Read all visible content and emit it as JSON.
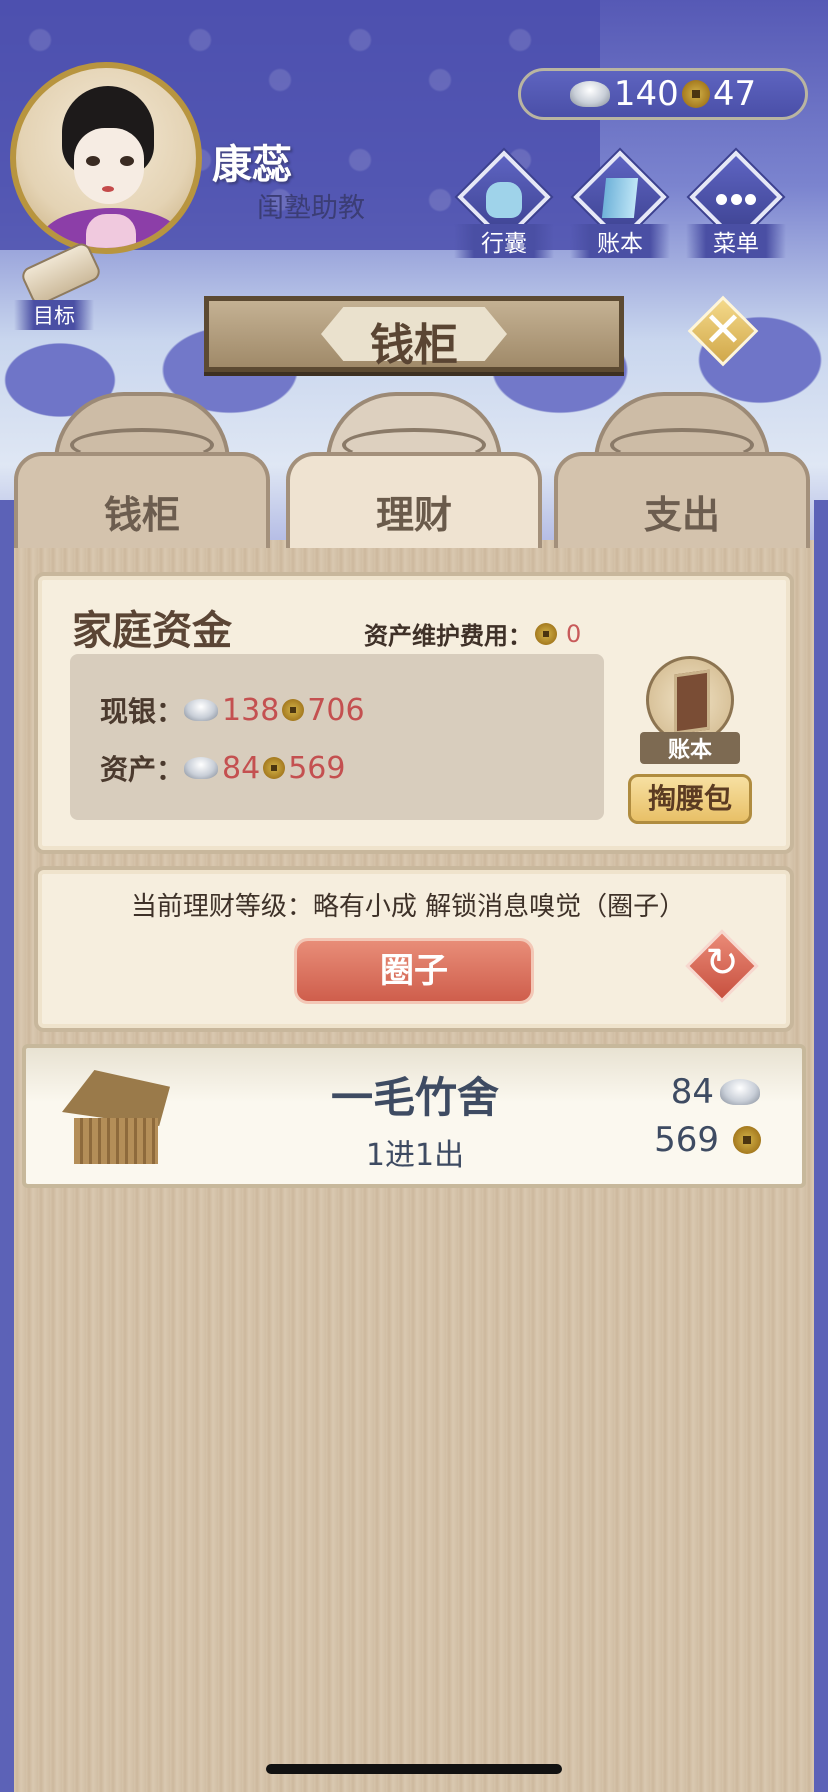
{
  "header": {
    "player_name": "康蕊",
    "player_title": "闺塾助教",
    "silver": "140",
    "coins": "47",
    "buttons": [
      {
        "label": "行囊",
        "icon": "bag-icon"
      },
      {
        "label": "账本",
        "icon": "ledger-icon"
      },
      {
        "label": "菜单",
        "icon": "menu-dots-icon"
      }
    ],
    "goal_label": "目标"
  },
  "title": "钱柜",
  "tabs": [
    {
      "label": "钱柜",
      "active": false
    },
    {
      "label": "理财",
      "active": true
    },
    {
      "label": "支出",
      "active": false
    }
  ],
  "family_funds": {
    "title": "家庭资金",
    "upkeep_label": "资产维护费用：",
    "upkeep_value": "0",
    "cash_label": "现银：",
    "cash_silver": "138",
    "cash_coins": "706",
    "assets_label": "资产：",
    "assets_silver": "84",
    "assets_coins": "569",
    "ledger_label": "账本",
    "pocket_label": "掏腰包"
  },
  "finance": {
    "level_text": "当前理财等级：略有小成 解锁消息嗅觉（圈子）",
    "circle_button": "圈子"
  },
  "property": {
    "name": "一毛竹舍",
    "sub": "1进1出",
    "silver": "84",
    "coins": "569"
  },
  "colors": {
    "accent_red": "#c45050",
    "header_blue": "#5659b5",
    "panel_wood": "#d6c4ab"
  }
}
